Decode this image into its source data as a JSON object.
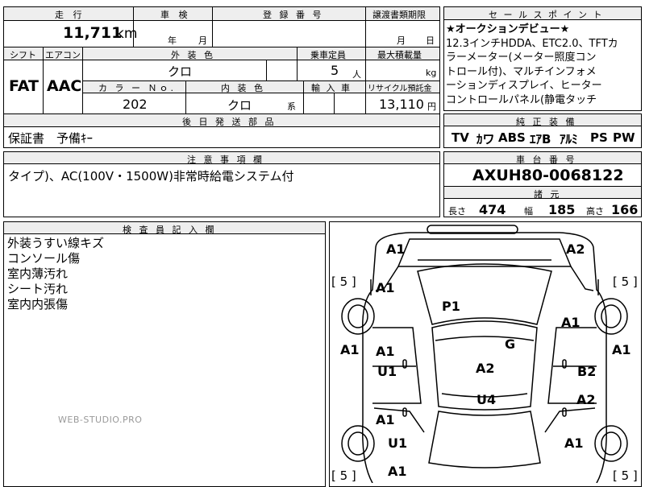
{
  "top_table": {
    "headers": {
      "mileage": "走 行",
      "shaken": "車 検",
      "registration": "登 録 番 号",
      "transfer_deadline": "譲渡書類期限",
      "shift": "シフト",
      "aircon": "エアコン",
      "exterior_color": "外 装 色",
      "capacity": "乗車定員",
      "max_load": "最大積載量",
      "color_no": "カ ラ ー Ｎｏ.",
      "interior_color": "内 装 色",
      "import": "輸 入 車",
      "recycle": "リサイクル預託金",
      "later_parts": "後 日 発 送 部 品",
      "notes": "注 意 事 項 欄",
      "inspector": "検 査 員 記 入 欄"
    },
    "mileage_value": "11,711",
    "mileage_unit": "km",
    "shaken_year": "年",
    "shaken_month": "月",
    "transfer_month": "月",
    "transfer_day": "日",
    "shift_value": "FAT",
    "aircon_value": "AAC",
    "exterior_color_value": "クロ",
    "capacity_value": "5",
    "capacity_unit": "人",
    "max_load_unit": "kg",
    "color_no_value": "202",
    "interior_color_value": "クロ",
    "interior_color_suffix": "系",
    "recycle_value": "13,110",
    "recycle_unit": "円",
    "later_parts_value": "保証書　予備ｷｰ",
    "notes_value": "タイプ)、AC(100V・1500W)非常時給電システム付"
  },
  "sales_points": {
    "header": "セ ー ル ス ポ イ ン ト",
    "lines": [
      "★オークションデビュー★",
      "12.3インチHDDA、ETC2.0、TFTカ",
      "ラーメーター(メーター照度コン",
      "トロール付)、マルチインフォメ",
      "ーションディスプレイ、ヒーター",
      "コントロールパネル(静電タッチ"
    ]
  },
  "equipment": {
    "header": "純 正 装 備",
    "items": [
      "TV",
      "ｶワ",
      "ABS",
      "ｴｱB",
      "ｱﾙﾐ",
      "PS",
      "PW"
    ]
  },
  "chassis": {
    "header": "車 台 番 号",
    "value": "AXUH80-0068122"
  },
  "specs": {
    "header": "諸 元",
    "length_label": "長さ",
    "length_value": "474",
    "width_label": "幅",
    "width_value": "185",
    "height_label": "高さ",
    "height_value": "166"
  },
  "inspector_notes": [
    "外装うすい線キズ",
    "コンソール傷",
    "室内薄汚れ",
    "シート汚れ",
    "室内内張傷"
  ],
  "watermark": "WEB-STUDIO.PRO",
  "diagram": {
    "tire_labels": [
      "[ 5 ]",
      "[ 5 ]",
      "[ 5 ]",
      "[ 5 ]"
    ],
    "marks": [
      "A1",
      "A2",
      "A1",
      "P1",
      "A1",
      "G",
      "A1",
      "A1",
      "A1",
      "U1",
      "A2",
      "B2",
      "U4",
      "A2",
      "A1",
      "U1",
      "A1",
      "A1"
    ]
  }
}
